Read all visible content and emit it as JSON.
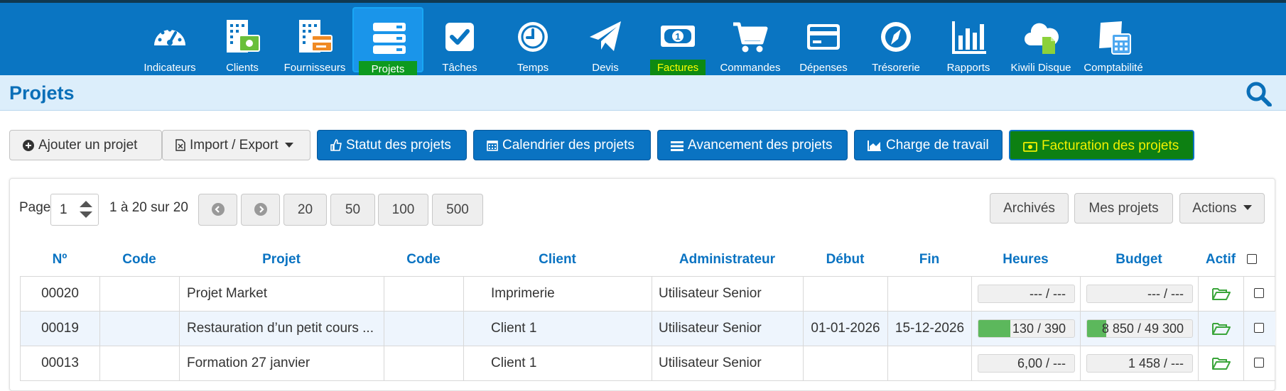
{
  "nav": [
    {
      "label": "Indicateurs",
      "icon": "dashboard-gauge-icon"
    },
    {
      "label": "Clients",
      "icon": "building-money-icon"
    },
    {
      "label": "Fournisseurs",
      "icon": "building-card-icon"
    },
    {
      "label": "Projets",
      "icon": "projects-stack-icon",
      "active": true
    },
    {
      "label": "Tâches",
      "icon": "checkbox-icon"
    },
    {
      "label": "Temps",
      "icon": "clock-icon"
    },
    {
      "label": "Devis",
      "icon": "paper-plane-icon"
    },
    {
      "label": "Factures",
      "icon": "banknote-icon"
    },
    {
      "label": "Commandes",
      "icon": "cart-icon"
    },
    {
      "label": "Dépenses",
      "icon": "credit-card-icon"
    },
    {
      "label": "Trésorerie",
      "icon": "compass-icon"
    },
    {
      "label": "Rapports",
      "icon": "bar-chart-icon"
    },
    {
      "label": "Kiwili Disque",
      "icon": "cloud-file-icon"
    },
    {
      "label": "Comptabilité",
      "icon": "calculator-icon"
    }
  ],
  "page_title": "Projets",
  "actions": {
    "add": "Ajouter un projet",
    "import_export": "Import / Export",
    "status": "Statut des projets",
    "calendar": "Calendrier des projets",
    "progress": "Avancement des projets",
    "workload": "Charge de travail",
    "billing": "Facturation des projets"
  },
  "pagination": {
    "page_label": "Page",
    "page_value": "1",
    "range": "1 à 20 sur 20",
    "sizes": [
      "20",
      "50",
      "100",
      "500"
    ]
  },
  "filters": {
    "archived": "Archivés",
    "mine": "Mes projets",
    "actions": "Actions"
  },
  "columns": [
    "Nº",
    "Code",
    "Projet",
    "Code",
    "Client",
    "Administrateur",
    "Début",
    "Fin",
    "Heures",
    "Budget",
    "Actif"
  ],
  "rows": [
    {
      "num": "00020",
      "code1": "",
      "project": "Projet Market",
      "code2": "",
      "client": "Imprimerie",
      "admin": "Utilisateur Senior",
      "start": "",
      "end": "",
      "hours": "--- / ---",
      "hours_pct": 0,
      "budget": "--- / ---",
      "budget_pct": 0
    },
    {
      "num": "00019",
      "code1": "",
      "project": "Restauration d’un petit cours ...",
      "code2": "",
      "client": "Client 1",
      "admin": "Utilisateur Senior",
      "start": "01-01-2026",
      "end": "15-12-2026",
      "hours": "130 / 390",
      "hours_pct": 0.33,
      "budget": "8 850 / 49 300",
      "budget_pct": 0.18
    },
    {
      "num": "00013",
      "code1": "",
      "project": "Formation 27 janvier",
      "code2": "",
      "client": "Client 1",
      "admin": "Utilisateur Senior",
      "start": "",
      "end": "",
      "hours": "6,00 / ---",
      "hours_pct": 0,
      "budget": "1 458 / ---",
      "budget_pct": 0
    }
  ]
}
